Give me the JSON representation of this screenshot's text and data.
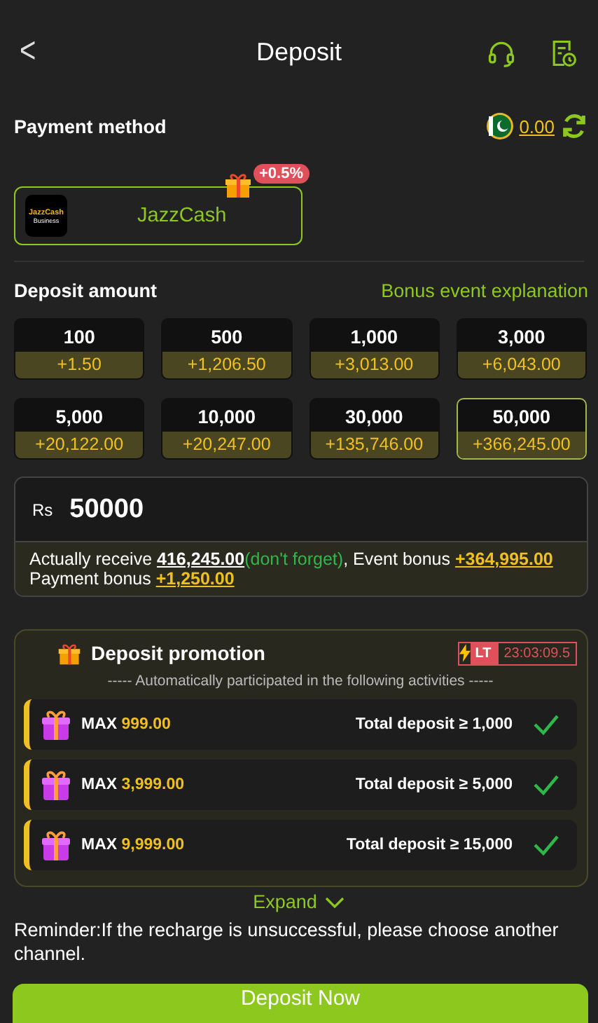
{
  "header": {
    "back": "<",
    "title": "Deposit"
  },
  "payment": {
    "title": "Payment method",
    "balance": "0.00",
    "methods": [
      {
        "name": "JazzCash",
        "logo_top": "JazzCash",
        "logo_bottom": "Business",
        "badge": "+0.5%",
        "selected": true
      }
    ]
  },
  "amount": {
    "title": "Deposit amount",
    "link": "Bonus event explanation",
    "options": [
      {
        "amount": "100",
        "bonus": "+1.50",
        "selected": false
      },
      {
        "amount": "500",
        "bonus": "+1,206.50",
        "selected": false
      },
      {
        "amount": "1,000",
        "bonus": "+3,013.00",
        "selected": false
      },
      {
        "amount": "3,000",
        "bonus": "+6,043.00",
        "selected": false
      },
      {
        "amount": "5,000",
        "bonus": "+20,122.00",
        "selected": false
      },
      {
        "amount": "10,000",
        "bonus": "+20,247.00",
        "selected": false
      },
      {
        "amount": "30,000",
        "bonus": "+135,746.00",
        "selected": false
      },
      {
        "amount": "50,000",
        "bonus": "+366,245.00",
        "selected": true
      }
    ]
  },
  "input": {
    "currency": "Rs",
    "value": "50000"
  },
  "summary": {
    "receive_label": "Actually receive",
    "receive_value": "416,245.00",
    "receive_note": "(don't forget)",
    "event_label": ", Event bonus",
    "event_value": "+364,995.00",
    "payment_label": "Payment bonus",
    "payment_value": "+1,250.00"
  },
  "promotion": {
    "title": "Deposit promotion",
    "tag": "LT",
    "timer": "23:03:09.5",
    "subtitle": "----- Automatically participated in the following activities -----",
    "rows": [
      {
        "max_label": "MAX",
        "max_value": "999.00",
        "condition": "Total deposit ≥ 1,000",
        "checked": true
      },
      {
        "max_label": "MAX",
        "max_value": "3,999.00",
        "condition": "Total deposit ≥ 5,000",
        "checked": true
      },
      {
        "max_label": "MAX",
        "max_value": "9,999.00",
        "condition": "Total deposit ≥ 15,000",
        "checked": true
      }
    ],
    "expand": "Expand"
  },
  "reminder": "Reminder:If the recharge is unsuccessful, please choose another channel.",
  "submit": "Deposit Now"
}
